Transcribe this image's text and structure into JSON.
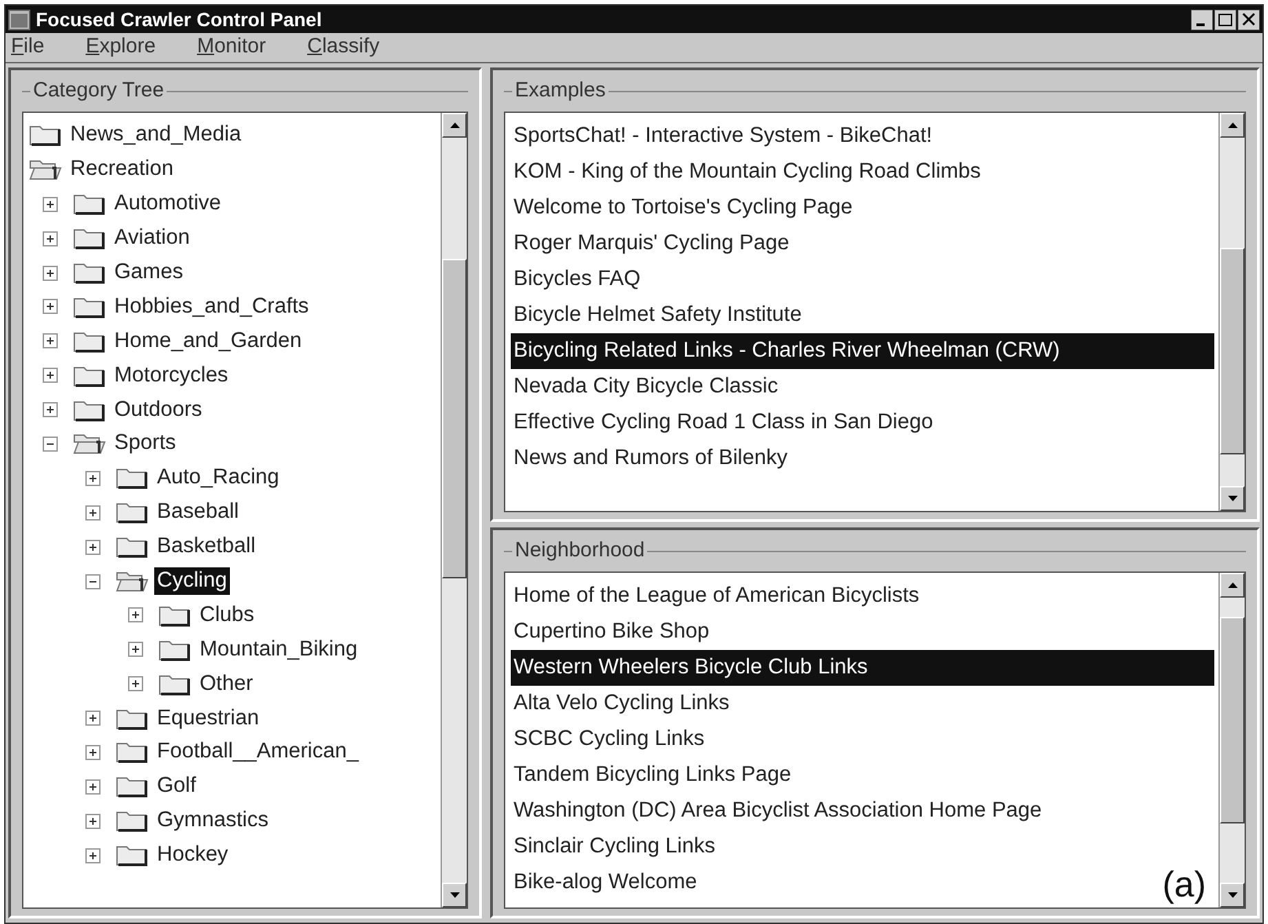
{
  "window": {
    "title": "Focused Crawler Control Panel"
  },
  "menu": [
    "File",
    "Explore",
    "Monitor",
    "Classify"
  ],
  "category_tree": {
    "title": "Category Tree",
    "items": [
      {
        "label": "News_and_Media",
        "expanded": false,
        "selected": false
      },
      {
        "label": "Recreation",
        "expanded": true,
        "selected": false,
        "children": [
          {
            "label": "Automotive",
            "expanded": false,
            "selected": false
          },
          {
            "label": "Aviation",
            "expanded": false,
            "selected": false
          },
          {
            "label": "Games",
            "expanded": false,
            "selected": false
          },
          {
            "label": "Hobbies_and_Crafts",
            "expanded": false,
            "selected": false
          },
          {
            "label": "Home_and_Garden",
            "expanded": false,
            "selected": false
          },
          {
            "label": "Motorcycles",
            "expanded": false,
            "selected": false
          },
          {
            "label": "Outdoors",
            "expanded": false,
            "selected": false
          },
          {
            "label": "Sports",
            "expanded": true,
            "selected": false,
            "children": [
              {
                "label": "Auto_Racing",
                "expanded": false,
                "selected": false
              },
              {
                "label": "Baseball",
                "expanded": false,
                "selected": false
              },
              {
                "label": "Basketball",
                "expanded": false,
                "selected": false
              },
              {
                "label": "Cycling",
                "expanded": true,
                "selected": true,
                "children": [
                  {
                    "label": "Clubs",
                    "expanded": false,
                    "selected": false
                  },
                  {
                    "label": "Mountain_Biking",
                    "expanded": false,
                    "selected": false
                  },
                  {
                    "label": "Other",
                    "expanded": false,
                    "selected": false
                  }
                ]
              },
              {
                "label": "Equestrian",
                "expanded": false,
                "selected": false
              },
              {
                "label": "Football__American_",
                "expanded": false,
                "selected": false
              },
              {
                "label": "Golf",
                "expanded": false,
                "selected": false
              },
              {
                "label": "Gymnastics",
                "expanded": false,
                "selected": false
              },
              {
                "label": "Hockey",
                "expanded": false,
                "selected": false
              }
            ]
          }
        ]
      }
    ]
  },
  "examples": {
    "title": "Examples",
    "items": [
      {
        "label": "SportsChat! - Interactive System - BikeChat!",
        "selected": false
      },
      {
        "label": "KOM - King of the Mountain Cycling Road Climbs",
        "selected": false
      },
      {
        "label": "Welcome to Tortoise's Cycling Page",
        "selected": false
      },
      {
        "label": "Roger Marquis' Cycling Page",
        "selected": false
      },
      {
        "label": "Bicycles FAQ",
        "selected": false
      },
      {
        "label": "Bicycle Helmet Safety Institute",
        "selected": false
      },
      {
        "label": "Bicycling Related Links - Charles River Wheelman (CRW)",
        "selected": true
      },
      {
        "label": "Nevada City Bicycle Classic",
        "selected": false
      },
      {
        "label": "Effective Cycling Road 1 Class in San Diego",
        "selected": false
      },
      {
        "label": "News and Rumors of Bilenky",
        "selected": false
      }
    ]
  },
  "neighborhood": {
    "title": "Neighborhood",
    "items": [
      {
        "label": "Home of the League of American Bicyclists",
        "selected": false
      },
      {
        "label": "Cupertino Bike Shop",
        "selected": false
      },
      {
        "label": "Western Wheelers Bicycle Club Links",
        "selected": true
      },
      {
        "label": "Alta Velo Cycling Links",
        "selected": false
      },
      {
        "label": "SCBC Cycling Links",
        "selected": false
      },
      {
        "label": "Tandem Bicycling Links Page",
        "selected": false
      },
      {
        "label": "Washington (DC) Area Bicyclist Association Home Page",
        "selected": false
      },
      {
        "label": "Sinclair Cycling Links",
        "selected": false
      },
      {
        "label": "Bike-alog Welcome",
        "selected": false
      }
    ]
  },
  "figure_label": "(a)"
}
